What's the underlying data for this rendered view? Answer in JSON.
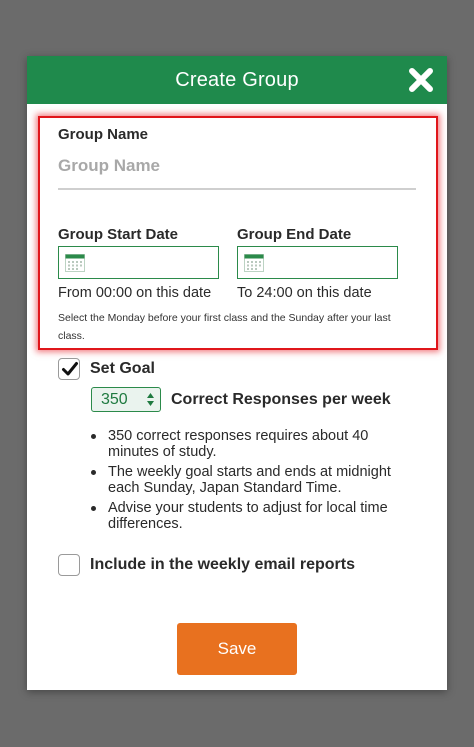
{
  "modal": {
    "title": "Create Group",
    "close_icon": "close-x-icon"
  },
  "group_name": {
    "label": "Group Name",
    "value": "",
    "placeholder": "Group Name"
  },
  "start_date": {
    "label": "Group Start Date",
    "value": "",
    "note": "From 00:00 on this date",
    "icon": "calendar-icon"
  },
  "end_date": {
    "label": "Group End Date",
    "value": "",
    "note": "To 24:00 on this date",
    "icon": "calendar-icon"
  },
  "date_help": "Select the Monday before your first class and the Sunday after your last class.",
  "set_goal": {
    "checked": true,
    "label": "Set Goal",
    "selected_value": "350",
    "unit_label": "Correct Responses per week",
    "bullets": [
      "350 correct responses requires about 40 minutes of study.",
      "The weekly goal starts and ends at midnight each Sunday, Japan Standard Time.",
      "Advise your students to adjust for local time differences."
    ]
  },
  "email_reports": {
    "checked": false,
    "label": "Include in the weekly email reports"
  },
  "save_label": "Save",
  "colors": {
    "header": "#1f8a4c",
    "accent_green": "#2b8a4a",
    "save": "#e8711f",
    "highlight": "#e0161b",
    "overlay": "#6b6b6b"
  }
}
